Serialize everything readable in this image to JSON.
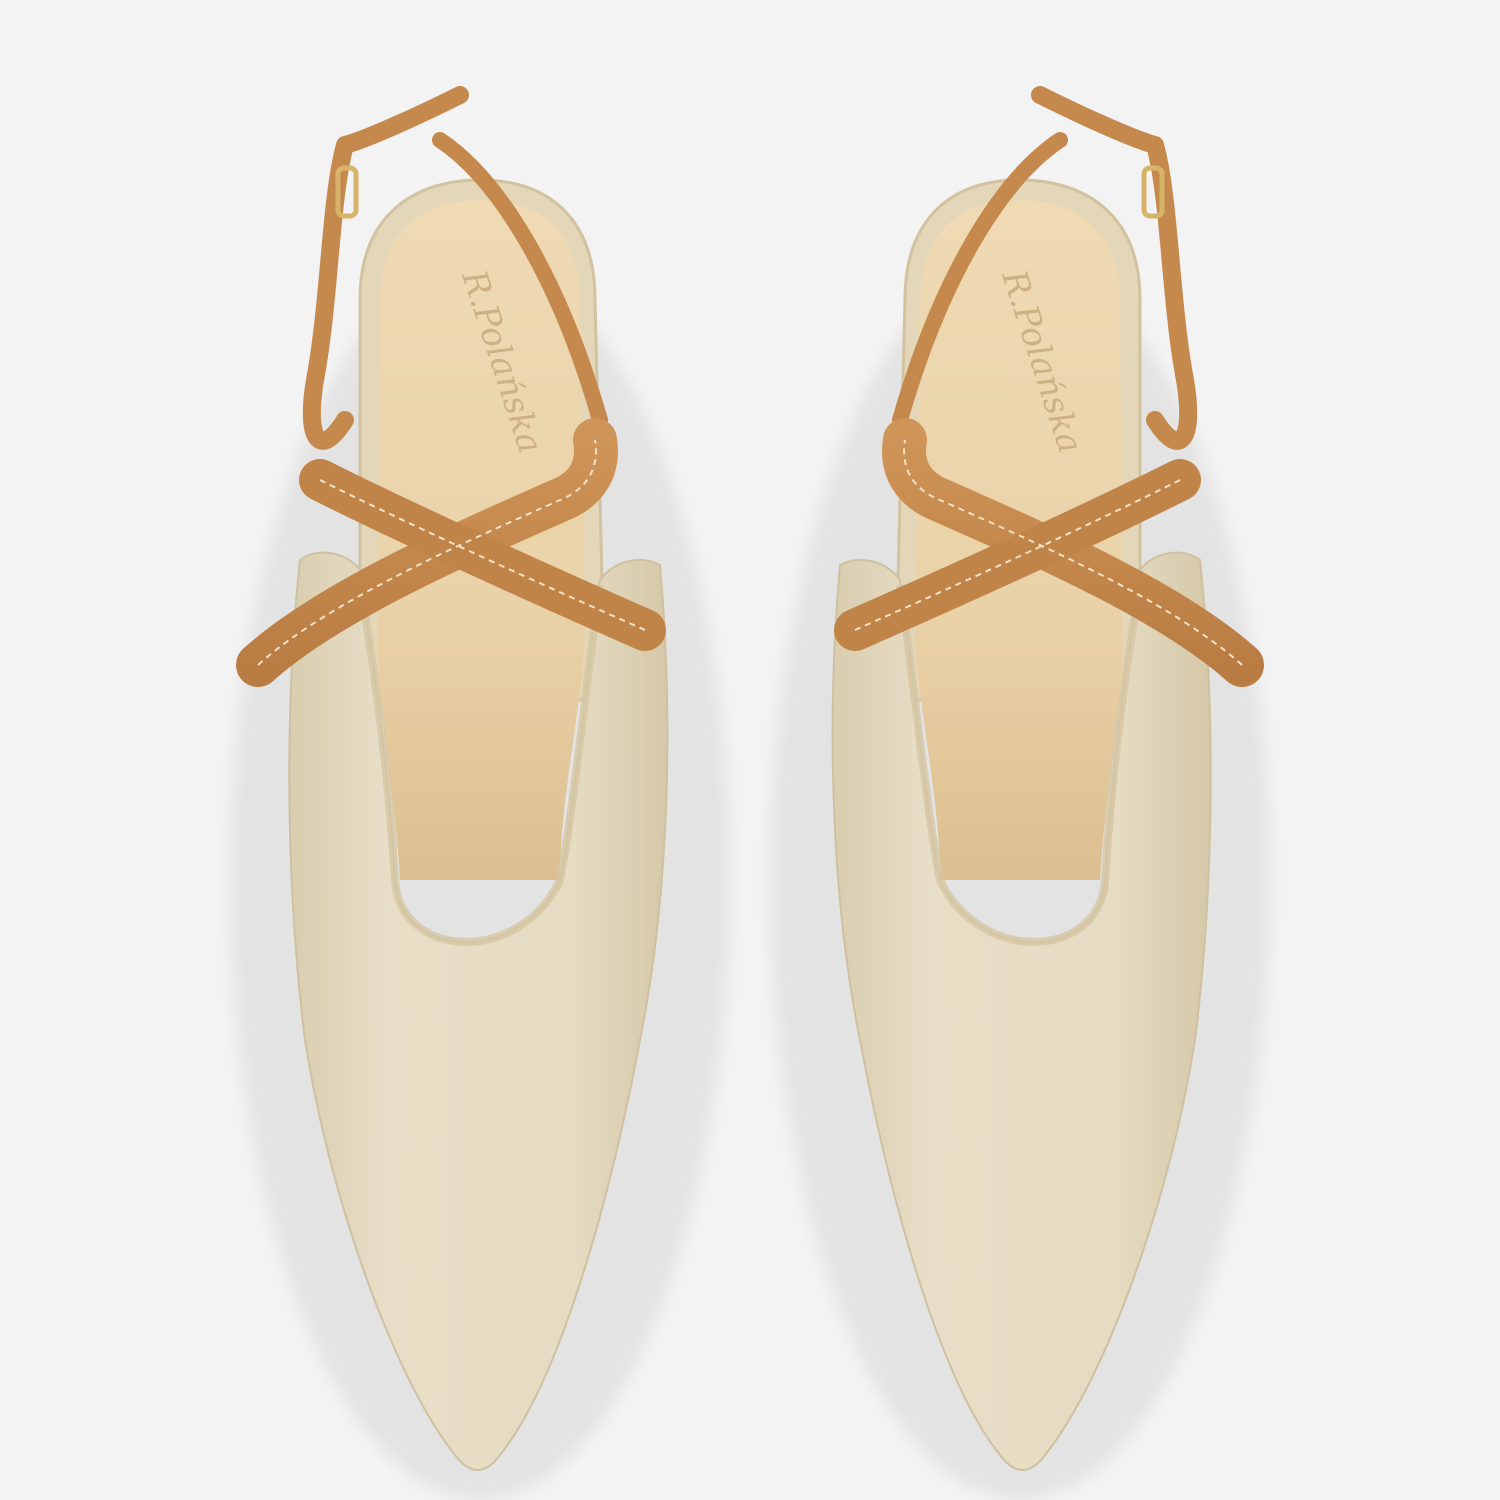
{
  "photo": {
    "colors": {
      "background": "#f3f3f3",
      "upper": "#e6dcc4",
      "upper_shadow": "#d6caa9",
      "insole": "#ecd5ad",
      "insole_shadow": "#d8bb8b",
      "strap": "#c78b4f",
      "strap_dark": "#a8703c",
      "stitch": "#f3e2c6",
      "buckle": "#d8b46a"
    },
    "insole_logo": "R.Polańska"
  }
}
